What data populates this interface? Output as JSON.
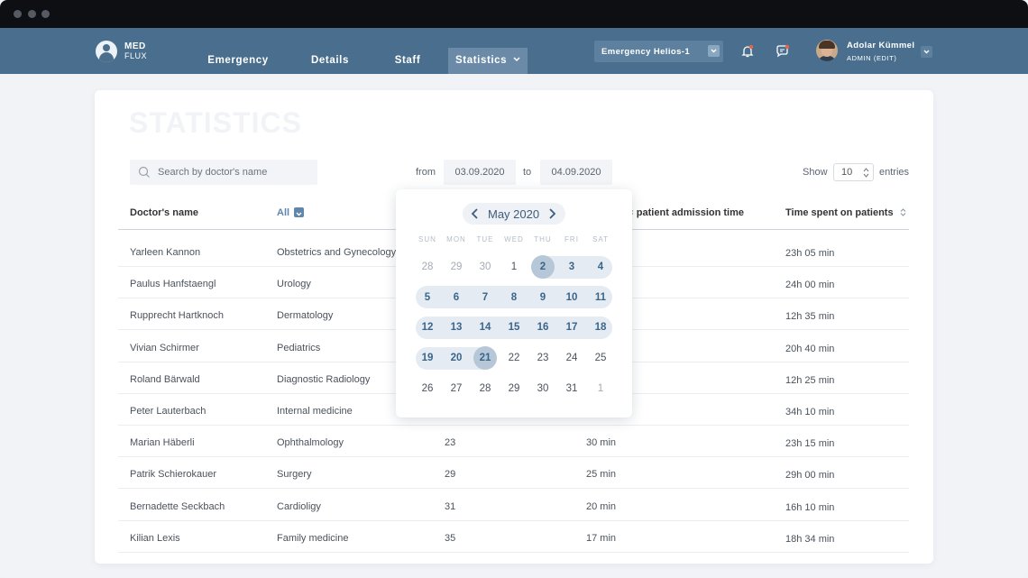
{
  "app": {
    "logo_line1": "MED",
    "logo_line2": "FLUX"
  },
  "nav": {
    "items": [
      "Emergency",
      "Details",
      "Staff",
      "Statistics"
    ]
  },
  "org_select": {
    "value": "Emergency Helios-1"
  },
  "user": {
    "name": "Adolar Kümmel",
    "role": "ADMIN (EDIT)"
  },
  "page": {
    "title": "STATISTICS"
  },
  "search": {
    "placeholder": "Search by doctor's name"
  },
  "date_range": {
    "from_label": "from",
    "from_value": "03.09.2020",
    "to_label": "to",
    "to_value": "04.09.2020"
  },
  "show_entries": {
    "show_label": "Show",
    "value": "10",
    "entries_label": "entries"
  },
  "table": {
    "columns": [
      "Doctor's name",
      "All",
      "",
      "patient admission time",
      "Time spent on patients"
    ],
    "rows": [
      {
        "name": "Yarleen Kannon",
        "dept": "Obstetrics and Gynecology",
        "patients": "",
        "admission": "",
        "time": "23h 05 min"
      },
      {
        "name": "Paulus Hanfstaengl",
        "dept": "Urology",
        "patients": "",
        "admission": "",
        "time": "24h 00 min"
      },
      {
        "name": "Rupprecht Hartknoch",
        "dept": "Dermatology",
        "patients": "",
        "admission": "",
        "time": "12h 35 min"
      },
      {
        "name": "Vivian Schirmer",
        "dept": "Pediatrics",
        "patients": "",
        "admission": "",
        "time": "20h 40 min"
      },
      {
        "name": "Roland Bärwald",
        "dept": "Diagnostic Radiology",
        "patients": "",
        "admission": "",
        "time": "12h 25 min"
      },
      {
        "name": "Peter Lauterbach",
        "dept": "Internal medicine",
        "patients": "",
        "admission": "",
        "time": "34h 10 min"
      },
      {
        "name": "Marian Häberli",
        "dept": "Ophthalmology",
        "patients": "23",
        "admission": "30 min",
        "time": "23h 15 min"
      },
      {
        "name": "Patrik Schierokauer",
        "dept": "Surgery",
        "patients": "29",
        "admission": "25 min",
        "time": "29h 00 min"
      },
      {
        "name": "Bernadette Seckbach",
        "dept": "Cardioligy",
        "patients": "31",
        "admission": "20 min",
        "time": "16h 10 min"
      },
      {
        "name": "Kilian Lexis",
        "dept": "Family medicine",
        "patients": "35",
        "admission": "17 min",
        "time": "18h 34 min"
      }
    ]
  },
  "calendar": {
    "title": "May 2020",
    "weekdays": [
      "SUN",
      "MON",
      "TUE",
      "WED",
      "THU",
      "FRI",
      "SAT"
    ],
    "weeks": [
      [
        "28",
        "29",
        "30",
        "1",
        "2",
        "3",
        "4"
      ],
      [
        "5",
        "6",
        "7",
        "8",
        "9",
        "10",
        "11"
      ],
      [
        "12",
        "13",
        "14",
        "15",
        "16",
        "17",
        "18"
      ],
      [
        "19",
        "20",
        "21",
        "22",
        "23",
        "24",
        "25"
      ],
      [
        "26",
        "27",
        "28",
        "29",
        "30",
        "31",
        "1"
      ]
    ],
    "range_start": "2",
    "range_end": "21"
  },
  "colors": {
    "nav_bg": "#4a6f8e",
    "accent": "#5f86ad",
    "range_bg": "#e4ebf2",
    "selected_day": "#b6c8d8"
  }
}
